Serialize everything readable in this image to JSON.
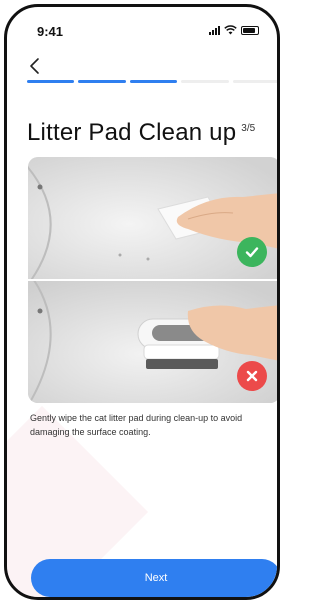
{
  "status_bar": {
    "time": "9:41"
  },
  "header": {
    "back_icon": "chevron-left-icon",
    "progress": {
      "total_steps": 5,
      "completed_steps": 3,
      "active_color": "#2f7ff0"
    }
  },
  "page": {
    "title": "Litter Pad Clean up",
    "step_indicator": "3/5"
  },
  "examples": [
    {
      "result": "correct",
      "icon": "check-icon",
      "color": "#3cb55d"
    },
    {
      "result": "incorrect",
      "icon": "close-icon",
      "color": "#ec4a4a"
    }
  ],
  "instruction": "Gently wipe the cat litter pad during clean-up to avoid damaging the surface coating.",
  "footer": {
    "next_label": "Next",
    "button_color": "#2f7ff0"
  }
}
